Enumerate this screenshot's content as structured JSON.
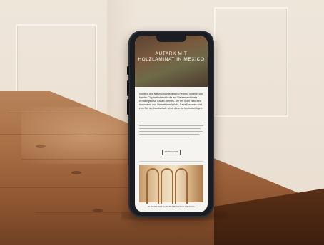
{
  "screen": {
    "hero_title": "AUTARK MIT HOLZLAMINAT IN MEXICO",
    "body": "Inmitten des Naturschutzgebiets El Pedrés, nördlich von Mexiko City, befindet sich die auf Stelzen errichtete Erholungsoase Casa Enormes. Die ein Spiel zwischen Innenraum und Umwelt ermöglicht. Casa Enormes wird zum Teil der Landschaft, ohne diese zu beeinträchtigen.",
    "more_label": "WEITERLESEN",
    "caption": "AUTARK MIT HOLZLAMINAT IN MEXICO"
  }
}
